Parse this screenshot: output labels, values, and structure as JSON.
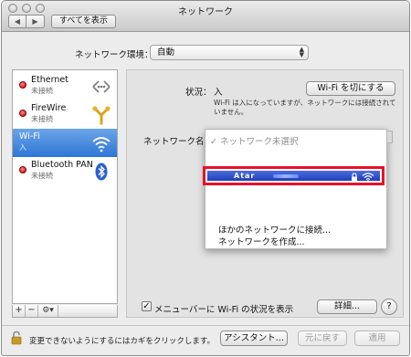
{
  "window": {
    "title": "ネットワーク",
    "back_icon": "◀",
    "forward_icon": "▶",
    "show_all_label": "すべてを表示"
  },
  "location": {
    "label": "ネットワーク環境：",
    "value": "自動"
  },
  "services": [
    {
      "name": "Ethernet",
      "status": "未接続",
      "icon": "ethernet-icon",
      "selected": false
    },
    {
      "name": "FireWire",
      "status": "未接続",
      "icon": "firewire-icon",
      "selected": false
    },
    {
      "name": "Wi-Fi",
      "status": "入",
      "icon": "wifi-icon",
      "selected": true
    },
    {
      "name": "Bluetooth PAN",
      "status": "未接続",
      "icon": "bluetooth-icon",
      "selected": false
    }
  ],
  "service_toolbar": {
    "add": "+",
    "remove": "−",
    "gear": "⚙▾"
  },
  "detail": {
    "status_label": "状況：",
    "status_value": "入",
    "wifi_off_button": "Wi-Fi を切にする",
    "status_description": "Wi-Fi は入になっていますが、ネットワークには接続されていません。",
    "network_name_label": "ネットワーク名："
  },
  "network_menu": {
    "header": "✓ ネットワーク未選択",
    "networks": [
      {
        "ssid": "Atar",
        "secured": true
      }
    ],
    "join_other": "ほかのネットワークに接続...",
    "create_network": "ネットワークを作成..."
  },
  "bottom": {
    "show_in_menubar_label": "メニューバーに Wi-Fi の状況を表示",
    "show_in_menubar_checked": "✓",
    "advanced_button": "詳細...",
    "help_button": "?"
  },
  "footer": {
    "lock_text": "変更できないようにするにはカギをクリックします。",
    "assist_button": "アシスタント...",
    "revert_button": "元に戻す",
    "apply_button": "適用"
  },
  "colors": {
    "selection_blue": "#2e76d6",
    "highlight_red": "#e8102a",
    "status_red": "#c20000"
  }
}
